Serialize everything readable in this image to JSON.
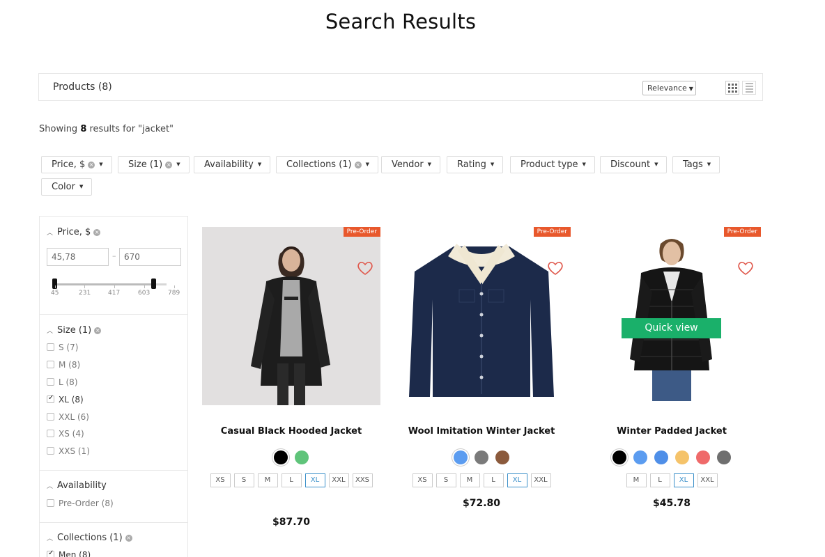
{
  "page_title": "Search Results",
  "toolbar": {
    "products_count": "Products (8)",
    "sort_label": "Relevance",
    "grid_view_icon": "grid-icon",
    "list_view_icon": "list-icon"
  },
  "showing": {
    "prefix": "Showing ",
    "count": "8",
    "suffix": " results for \"jacket\""
  },
  "filter_chips": [
    {
      "label": "Price, $",
      "clearable": true
    },
    {
      "label": "Size (1)",
      "clearable": true
    },
    {
      "label": "Availability",
      "clearable": false
    },
    {
      "label": "Collections (1)",
      "clearable": true
    },
    {
      "label": "Vendor",
      "clearable": false
    },
    {
      "label": "Rating",
      "clearable": false
    },
    {
      "label": "Product type",
      "clearable": false
    },
    {
      "label": "Discount",
      "clearable": false
    },
    {
      "label": "Tags",
      "clearable": false
    },
    {
      "label": "Color",
      "clearable": false
    }
  ],
  "sidebar": {
    "price": {
      "title": "Price, $",
      "min_value": "45,78",
      "max_value": "670",
      "ticks": [
        "45",
        "231",
        "417",
        "603",
        "789"
      ]
    },
    "size": {
      "title": "Size (1)",
      "options": [
        {
          "label": "S (7)",
          "checked": false
        },
        {
          "label": "M (8)",
          "checked": false
        },
        {
          "label": "L (8)",
          "checked": false
        },
        {
          "label": "XL (8)",
          "checked": true
        },
        {
          "label": "XXL (6)",
          "checked": false
        },
        {
          "label": "XS (4)",
          "checked": false
        },
        {
          "label": "XXS (1)",
          "checked": false
        }
      ]
    },
    "availability": {
      "title": "Availability",
      "options": [
        {
          "label": "Pre-Order (8)",
          "checked": false
        }
      ]
    },
    "collections": {
      "title": "Collections (1)",
      "options": [
        {
          "label": "Men (8)",
          "checked": true
        }
      ]
    }
  },
  "products": [
    {
      "name": "Casual Black Hooded Jacket",
      "badge": "Pre-Order",
      "price": "$87.70",
      "colors": [
        "#000000",
        "#5fc47a"
      ],
      "sizes": [
        "XS",
        "S",
        "M",
        "L",
        "XL",
        "XXL",
        "XXS"
      ],
      "selected_size": "XL"
    },
    {
      "name": "Wool Imitation Winter Jacket",
      "badge": "Pre-Order",
      "price": "$72.80",
      "colors": [
        "#5b9cf0",
        "#7a7a7a",
        "#8b5a3c"
      ],
      "sizes": [
        "XS",
        "S",
        "M",
        "L",
        "XL",
        "XXL"
      ],
      "selected_size": "XL"
    },
    {
      "name": "Winter Padded Jacket",
      "badge": "Pre-Order",
      "price": "$45.78",
      "quick_view": "Quick view",
      "colors": [
        "#000000",
        "#5b9cf0",
        "#4f8fe8",
        "#f5c36a",
        "#ef6a6a",
        "#6f6f6f"
      ],
      "sizes": [
        "M",
        "L",
        "XL",
        "XXL"
      ],
      "selected_size": "XL"
    }
  ],
  "colors": {
    "badge": "#e8582c",
    "quick_view": "#1ab06a",
    "selected_size": "#3a8fc9"
  }
}
